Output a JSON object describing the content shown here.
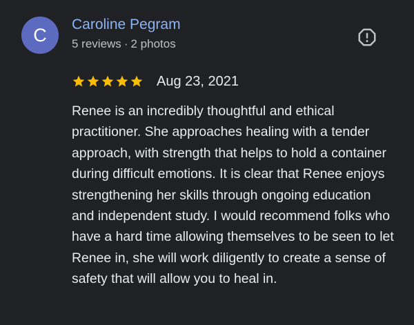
{
  "review": {
    "author": {
      "initial": "C",
      "name": "Caroline Pegram",
      "reviews": "5 reviews",
      "separator": "·",
      "photos": "2 photos"
    },
    "rating": 5,
    "date": "Aug 23, 2021",
    "text": "Renee is an incredibly thoughtful and ethical practitioner. She approaches healing with a tender approach, with strength that helps to hold a container during difficult emotions. It is clear that Renee enjoys strengthening her skills through ongoing education and independent study. I would recommend folks who have a hard time allowing themselves to be seen to let Renee in, she will work diligently to create a sense of safety that will allow you to heal in."
  },
  "icons": {
    "report": "report-flag-icon",
    "star": "star-icon"
  },
  "colors": {
    "background": "#202124",
    "avatar": "#5c6bc0",
    "author_name": "#8ab4f8",
    "meta_text": "#bdc1c6",
    "body_text": "#e8eaed",
    "star": "#fbbc04"
  }
}
